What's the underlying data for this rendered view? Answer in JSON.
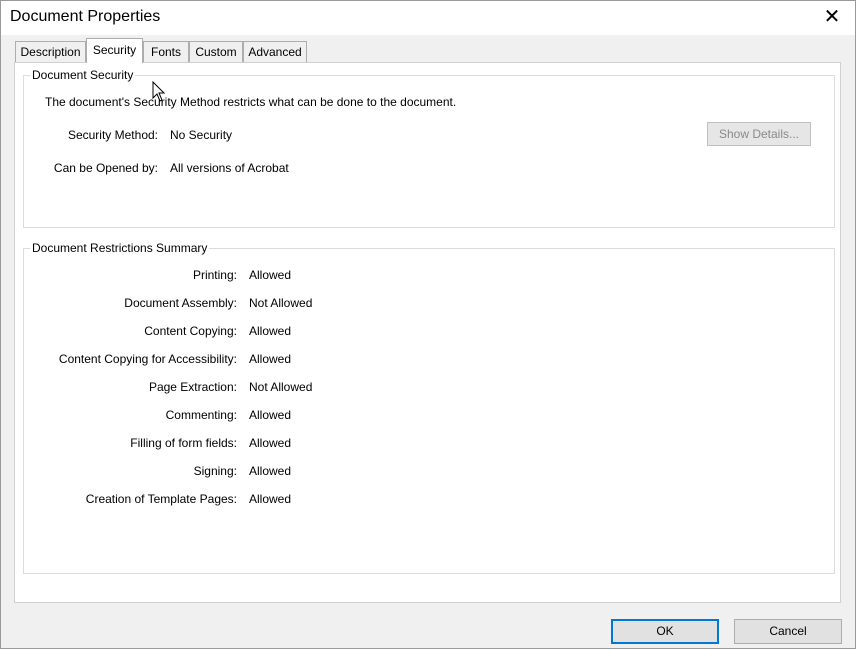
{
  "window": {
    "title": "Document Properties",
    "close_glyph": "✕"
  },
  "tabs": [
    {
      "label": "Description",
      "active": false
    },
    {
      "label": "Security",
      "active": true
    },
    {
      "label": "Fonts",
      "active": false
    },
    {
      "label": "Custom",
      "active": false
    },
    {
      "label": "Advanced",
      "active": false
    }
  ],
  "document_security": {
    "legend": "Document Security",
    "description": "The document's Security Method restricts what can be done to the document.",
    "security_method_label": "Security Method:",
    "security_method_value": "No Security",
    "can_be_opened_label": "Can be Opened by:",
    "can_be_opened_value": "All versions of Acrobat",
    "show_details_label": "Show Details..."
  },
  "restrictions": {
    "legend": "Document Restrictions Summary",
    "items": [
      {
        "label": "Printing:",
        "value": "Allowed"
      },
      {
        "label": "Document Assembly:",
        "value": "Not Allowed"
      },
      {
        "label": "Content Copying:",
        "value": "Allowed"
      },
      {
        "label": "Content Copying for Accessibility:",
        "value": "Allowed"
      },
      {
        "label": "Page Extraction:",
        "value": "Not Allowed"
      },
      {
        "label": "Commenting:",
        "value": "Allowed"
      },
      {
        "label": "Filling of form fields:",
        "value": "Allowed"
      },
      {
        "label": "Signing:",
        "value": "Allowed"
      },
      {
        "label": "Creation of Template Pages:",
        "value": "Allowed"
      }
    ]
  },
  "footer": {
    "ok_label": "OK",
    "cancel_label": "Cancel"
  },
  "colors": {
    "accent": "#0078d7",
    "disabled_text": "#8a8a8a"
  }
}
